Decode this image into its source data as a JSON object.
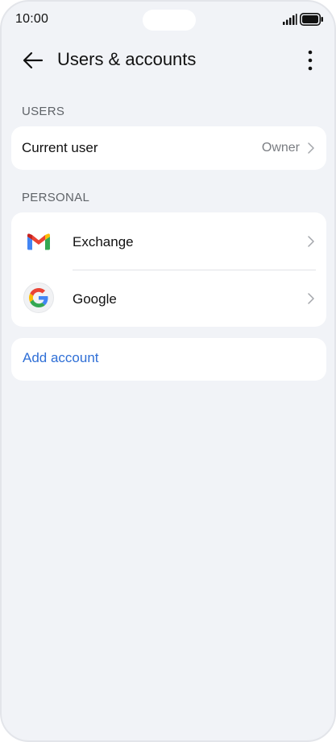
{
  "status_bar": {
    "time": "10:00",
    "signal_icon": "signal-icon",
    "battery_icon": "battery-icon"
  },
  "app_bar": {
    "back_icon": "arrow-left-icon",
    "title": "Users & accounts",
    "more_icon": "more-vertical-icon"
  },
  "users_section": {
    "header": "USERS",
    "current_user": {
      "label": "Current user",
      "value": "Owner"
    }
  },
  "personal_section": {
    "header": "PERSONAL",
    "accounts": [
      {
        "label": "Exchange",
        "icon": "gmail-icon"
      },
      {
        "label": "Google",
        "icon": "google-icon"
      }
    ]
  },
  "add_account": {
    "label": "Add account"
  },
  "colors": {
    "background": "#f1f3f7",
    "card": "#ffffff",
    "accent": "#2f6fd6",
    "secondary_text": "#5f6368"
  }
}
